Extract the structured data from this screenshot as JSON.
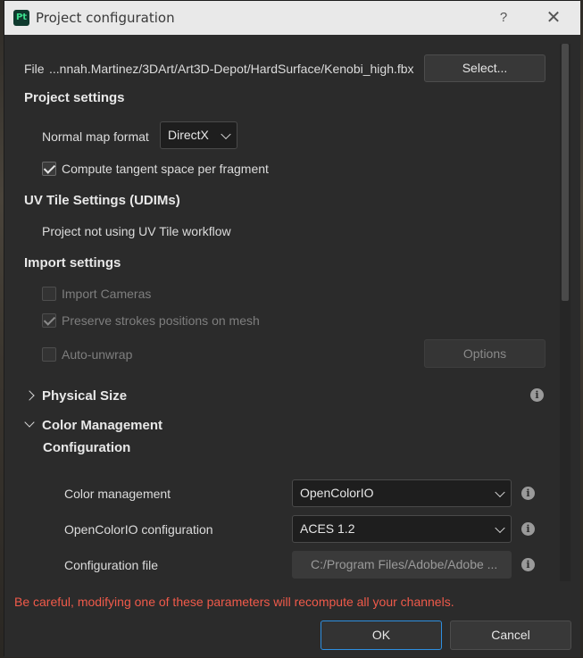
{
  "window": {
    "title": "Project configuration",
    "app_icon_text": "Pt",
    "help_glyph": "?",
    "close_glyph": "✕"
  },
  "file": {
    "label": "File",
    "path": "...nnah.Martinez/3DArt/Art3D-Depot/HardSurface/Kenobi_high.fbx",
    "select_button": "Select..."
  },
  "project_settings": {
    "heading": "Project settings",
    "normal_map_label": "Normal map format",
    "normal_map_value": "DirectX",
    "tangent_label": "Compute tangent space per fragment",
    "tangent_checked": true
  },
  "uv_tile": {
    "heading": "UV Tile Settings (UDIMs)",
    "status": "Project not using UV Tile workflow"
  },
  "import_settings": {
    "heading": "Import settings",
    "import_cameras_label": "Import Cameras",
    "import_cameras_checked": false,
    "preserve_strokes_label": "Preserve strokes positions on mesh",
    "preserve_strokes_checked": true,
    "auto_unwrap_label": "Auto-unwrap",
    "auto_unwrap_checked": false,
    "options_button": "Options"
  },
  "physical_size": {
    "heading": "Physical Size",
    "info_icon": "info-icon"
  },
  "color_management": {
    "heading": "Color Management",
    "subheading": "Configuration",
    "color_management_label": "Color management",
    "color_management_value": "OpenColorIO",
    "ocio_config_label": "OpenColorIO configuration",
    "ocio_config_value": "ACES 1.2",
    "config_file_label": "Configuration file",
    "config_file_value": "C:/Program Files/Adobe/Adobe ..."
  },
  "warning": "Be careful, modifying one of these parameters will recompute all your channels.",
  "footer": {
    "ok_button": "OK",
    "cancel_button": "Cancel"
  },
  "colors": {
    "dialog_bg": "#2b2b2b",
    "titlebar_bg": "#e9e9e9",
    "warning": "#f05a4a",
    "focus_accent": "#2e8fe0",
    "app_icon_accent": "#3be08e"
  }
}
